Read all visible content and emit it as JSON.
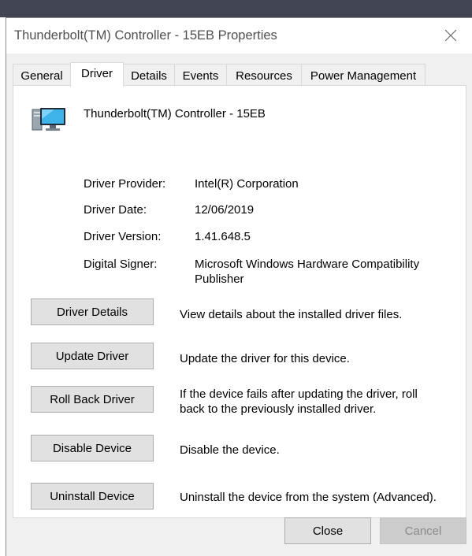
{
  "window": {
    "title": "Thunderbolt(TM) Controller - 15EB Properties",
    "close_icon": "close-icon"
  },
  "tabs": [
    {
      "label": "General",
      "active": false
    },
    {
      "label": "Driver",
      "active": true
    },
    {
      "label": "Details",
      "active": false
    },
    {
      "label": "Events",
      "active": false
    },
    {
      "label": "Resources",
      "active": false
    },
    {
      "label": "Power Management",
      "active": false
    }
  ],
  "device": {
    "name": "Thunderbolt(TM) Controller - 15EB",
    "icon": "computer-device-icon"
  },
  "driver_info": {
    "provider_label": "Driver Provider:",
    "provider_value": "Intel(R) Corporation",
    "date_label": "Driver Date:",
    "date_value": "12/06/2019",
    "version_label": "Driver Version:",
    "version_value": "1.41.648.5",
    "signer_label": "Digital Signer:",
    "signer_value_line1": "Microsoft Windows Hardware Compatibility",
    "signer_value_line2": "Publisher"
  },
  "actions": {
    "details_label": "Driver Details",
    "details_desc": "View details about the installed driver files.",
    "update_label": "Update Driver",
    "update_desc": "Update the driver for this device.",
    "rollback_label": "Roll Back Driver",
    "rollback_desc_line1": "If the device fails after updating the driver, roll",
    "rollback_desc_line2": "back to the previously installed driver.",
    "disable_label": "Disable Device",
    "disable_desc": "Disable the device.",
    "uninstall_label": "Uninstall Device",
    "uninstall_desc": "Uninstall the device from the system (Advanced)."
  },
  "footer": {
    "close_label": "Close",
    "cancel_label": "Cancel",
    "cancel_enabled": false
  },
  "colors": {
    "dialog_bg": "#f0f0f0",
    "panel_bg": "#ffffff",
    "button_bg": "#e1e1e1",
    "disabled_text": "#8a8a8a",
    "title_text": "#505050"
  }
}
